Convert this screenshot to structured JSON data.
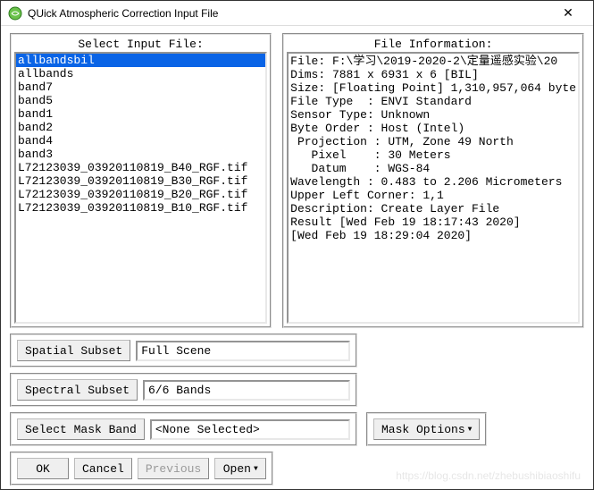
{
  "window": {
    "title": "QUick Atmospheric Correction Input File"
  },
  "left_panel": {
    "title": "Select Input File:",
    "items": [
      "allbandsbil",
      "allbands",
      "band7",
      "band5",
      "band1",
      "band2",
      "band4",
      "band3",
      "L72123039_03920110819_B40_RGF.tif",
      "L72123039_03920110819_B30_RGF.tif",
      "L72123039_03920110819_B20_RGF.tif",
      "L72123039_03920110819_B10_RGF.tif"
    ],
    "selected_index": 0
  },
  "right_panel": {
    "title": "File Information:",
    "lines": [
      "File: F:\\学习\\2019-2020-2\\定量遥感实验\\20",
      "Dims: 7881 x 6931 x 6 [BIL]",
      "Size: [Floating Point] 1,310,957,064 byte",
      "File Type  : ENVI Standard",
      "Sensor Type: Unknown",
      "Byte Order : Host (Intel)",
      " Projection : UTM, Zone 49 North",
      "   Pixel    : 30 Meters",
      "   Datum    : WGS-84",
      "Wavelength : 0.483 to 2.206 Micrometers",
      "Upper Left Corner: 1,1",
      "Description: Create Layer File",
      "Result [Wed Feb 19 18:17:43 2020]",
      "[Wed Feb 19 18:29:04 2020]"
    ]
  },
  "spatial_subset": {
    "label": "Spatial Subset",
    "value": "Full Scene"
  },
  "spectral_subset": {
    "label": "Spectral Subset",
    "value": "6/6 Bands"
  },
  "mask_band": {
    "label": "Select Mask Band",
    "value": "<None Selected>",
    "options_label": "Mask Options"
  },
  "buttons": {
    "ok": "OK",
    "cancel": "Cancel",
    "previous": "Previous",
    "open": "Open"
  },
  "watermark": "https://blog.csdn.net/zhebushibiaoshifu"
}
